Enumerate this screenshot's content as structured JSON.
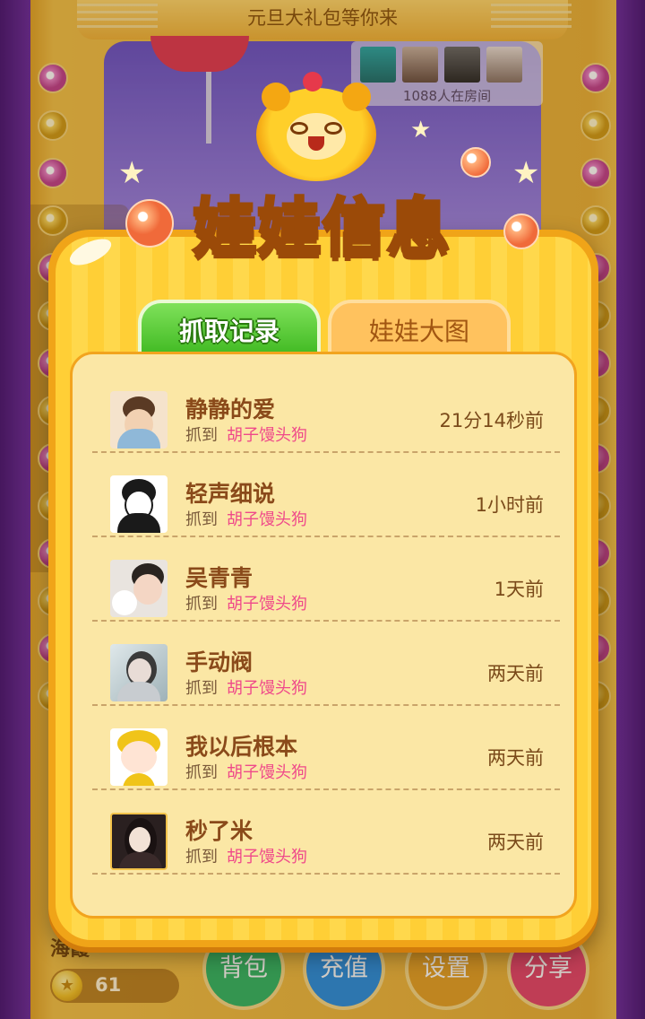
{
  "room": {
    "title": "元旦大礼包等你来",
    "count_text": "1088人在房间"
  },
  "bottom": {
    "user_name": "海霞",
    "coins": "61",
    "buttons": [
      {
        "label": "背包",
        "color": "#33b667"
      },
      {
        "label": "充值",
        "color": "#2a8fe0"
      },
      {
        "label": "设置",
        "color": "#e5a22a"
      },
      {
        "label": "分享",
        "color": "#e4466e"
      }
    ]
  },
  "modal": {
    "title": "娃娃信息",
    "tabs": [
      {
        "label": "抓取记录",
        "active": true
      },
      {
        "label": "娃娃大图",
        "active": false
      }
    ],
    "action_label": "抓到",
    "records": [
      {
        "name": "静静的爱",
        "item": "胡子馒头狗",
        "time": "21分14秒前"
      },
      {
        "name": "轻声细说",
        "item": "胡子馒头狗",
        "time": "1小时前"
      },
      {
        "name": "吴青青",
        "item": "胡子馒头狗",
        "time": "1天前"
      },
      {
        "name": "手动阀",
        "item": "胡子馒头狗",
        "time": "两天前"
      },
      {
        "name": "我以后根本",
        "item": "胡子馒头狗",
        "time": "两天前"
      },
      {
        "name": "秒了米",
        "item": "胡子馒头狗",
        "time": "两天前"
      }
    ]
  },
  "colors": {
    "accent_pink": "#ef4a8a",
    "tab_active_green": "#3eb820",
    "modal_orange": "#f0a418"
  }
}
